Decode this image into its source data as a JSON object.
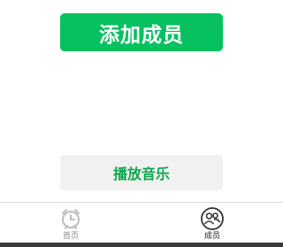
{
  "actions": {
    "add_member_label": "添加成员",
    "play_music_label": "播放音乐"
  },
  "tabbar": {
    "tabs": [
      {
        "label": "首页",
        "icon": "alarm-clock-icon",
        "active": false
      },
      {
        "label": "成员",
        "icon": "members-icon",
        "active": true
      }
    ]
  },
  "colors": {
    "primary": "#07c160",
    "play_text": "#0ea54f",
    "inactive_tab": "#8a8a8a",
    "active_tab": "#222222"
  }
}
